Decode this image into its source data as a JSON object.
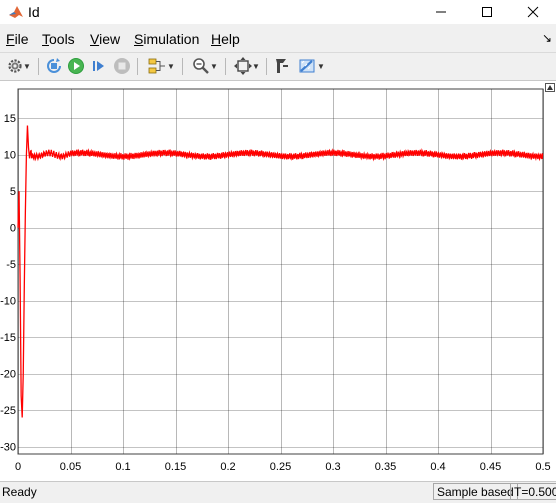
{
  "window": {
    "title": "Id"
  },
  "menu": {
    "items": [
      {
        "mnemonic": "F",
        "rest": "ile"
      },
      {
        "mnemonic": "T",
        "rest": "ools"
      },
      {
        "mnemonic": "V",
        "rest": "iew"
      },
      {
        "mnemonic": "S",
        "rest": "imulation"
      },
      {
        "mnemonic": "H",
        "rest": "elp"
      }
    ],
    "right_glyph": "↘"
  },
  "toolbar": {
    "icons": [
      "gear-icon",
      "stop-loop-icon",
      "run-icon",
      "step-forward-icon",
      "stop-icon",
      "signal-selector-icon",
      "zoom-icon",
      "fit-to-view-icon",
      "style-icon",
      "measurements-icon"
    ]
  },
  "chart_data": {
    "type": "line",
    "series": [
      {
        "color": "#ff0000",
        "x": [
          0,
          0.001,
          0.002,
          0.003,
          0.004,
          0.005,
          0.006,
          0.007,
          0.008,
          0.009,
          0.01,
          0.011,
          0.012,
          0.013,
          0.015,
          0.017,
          0.05,
          0.1,
          0.15,
          0.2,
          0.25,
          0.3,
          0.35,
          0.4,
          0.45,
          0.5
        ],
        "y": [
          0,
          5,
          -7,
          -23,
          -26,
          -20,
          -8,
          2,
          10,
          14,
          11,
          9.5,
          10.5,
          10,
          10,
          10,
          10,
          10,
          10,
          10,
          10,
          10,
          10,
          10,
          10,
          10
        ]
      }
    ],
    "noise_amplitude": 0.35,
    "xlim": [
      0,
      0.5
    ],
    "ylim": [
      -31,
      19
    ],
    "xticks": [
      "0",
      "0.05",
      "0.1",
      "0.15",
      "0.2",
      "0.25",
      "0.3",
      "0.35",
      "0.4",
      "0.45",
      "0.5"
    ],
    "xtick_values": [
      0,
      0.05,
      0.1,
      0.15,
      0.2,
      0.25,
      0.3,
      0.35,
      0.4,
      0.45,
      0.5
    ],
    "yticks": [
      "15",
      "10",
      "5",
      "0",
      "-5",
      "-10",
      "-15",
      "-20",
      "-25",
      "-30"
    ],
    "ytick_values": [
      15,
      10,
      5,
      0,
      -5,
      -10,
      -15,
      -20,
      -25,
      -30
    ],
    "grid": true
  },
  "status": {
    "ready": "Ready",
    "mode": "Sample based",
    "time": "T=0.500"
  }
}
